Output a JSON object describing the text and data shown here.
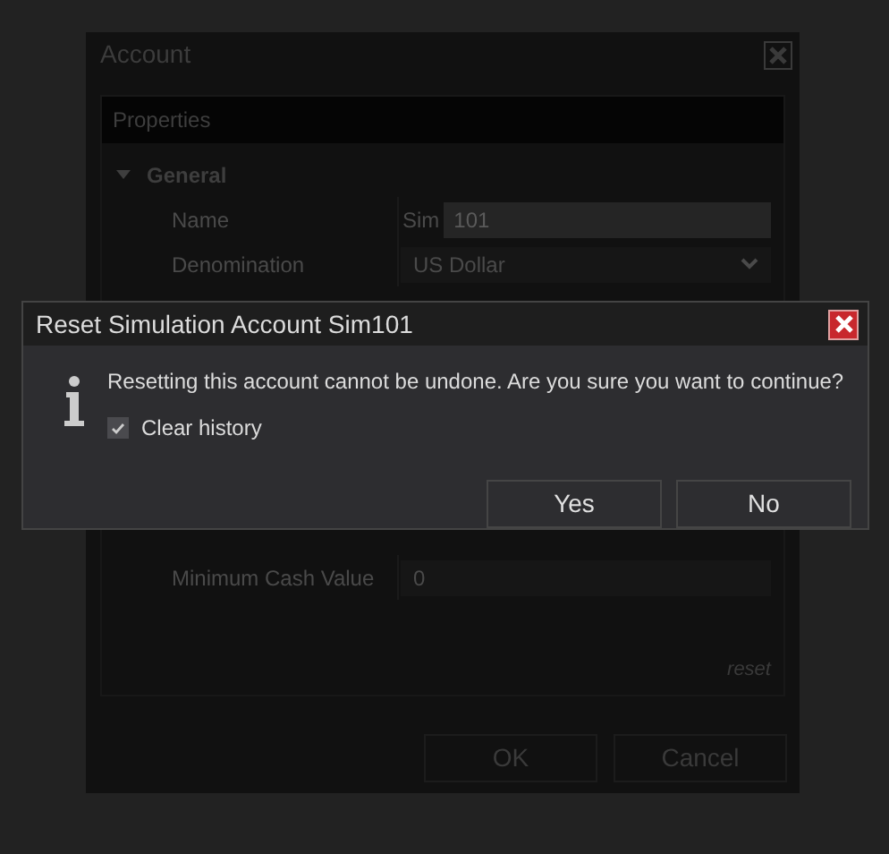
{
  "account_window": {
    "title": "Account",
    "section": "Properties",
    "group": {
      "label": "General",
      "expanded": true
    },
    "properties": [
      {
        "label": "Name",
        "prefix": "Sim",
        "value": "101"
      },
      {
        "label": "Denomination",
        "value": "US Dollar",
        "kind": "dropdown"
      },
      {
        "label": "Minimum Cash Value",
        "value": "0",
        "kind": "text"
      }
    ],
    "reset_link": "reset",
    "buttons": [
      "OK",
      "Cancel"
    ]
  },
  "dialog": {
    "title": "Reset Simulation Account Sim101",
    "message": "Resetting this account cannot be undone. Are you sure you want to continue?",
    "checkbox": {
      "label": "Clear history",
      "checked": true
    },
    "buttons": [
      "Yes",
      "No"
    ]
  }
}
